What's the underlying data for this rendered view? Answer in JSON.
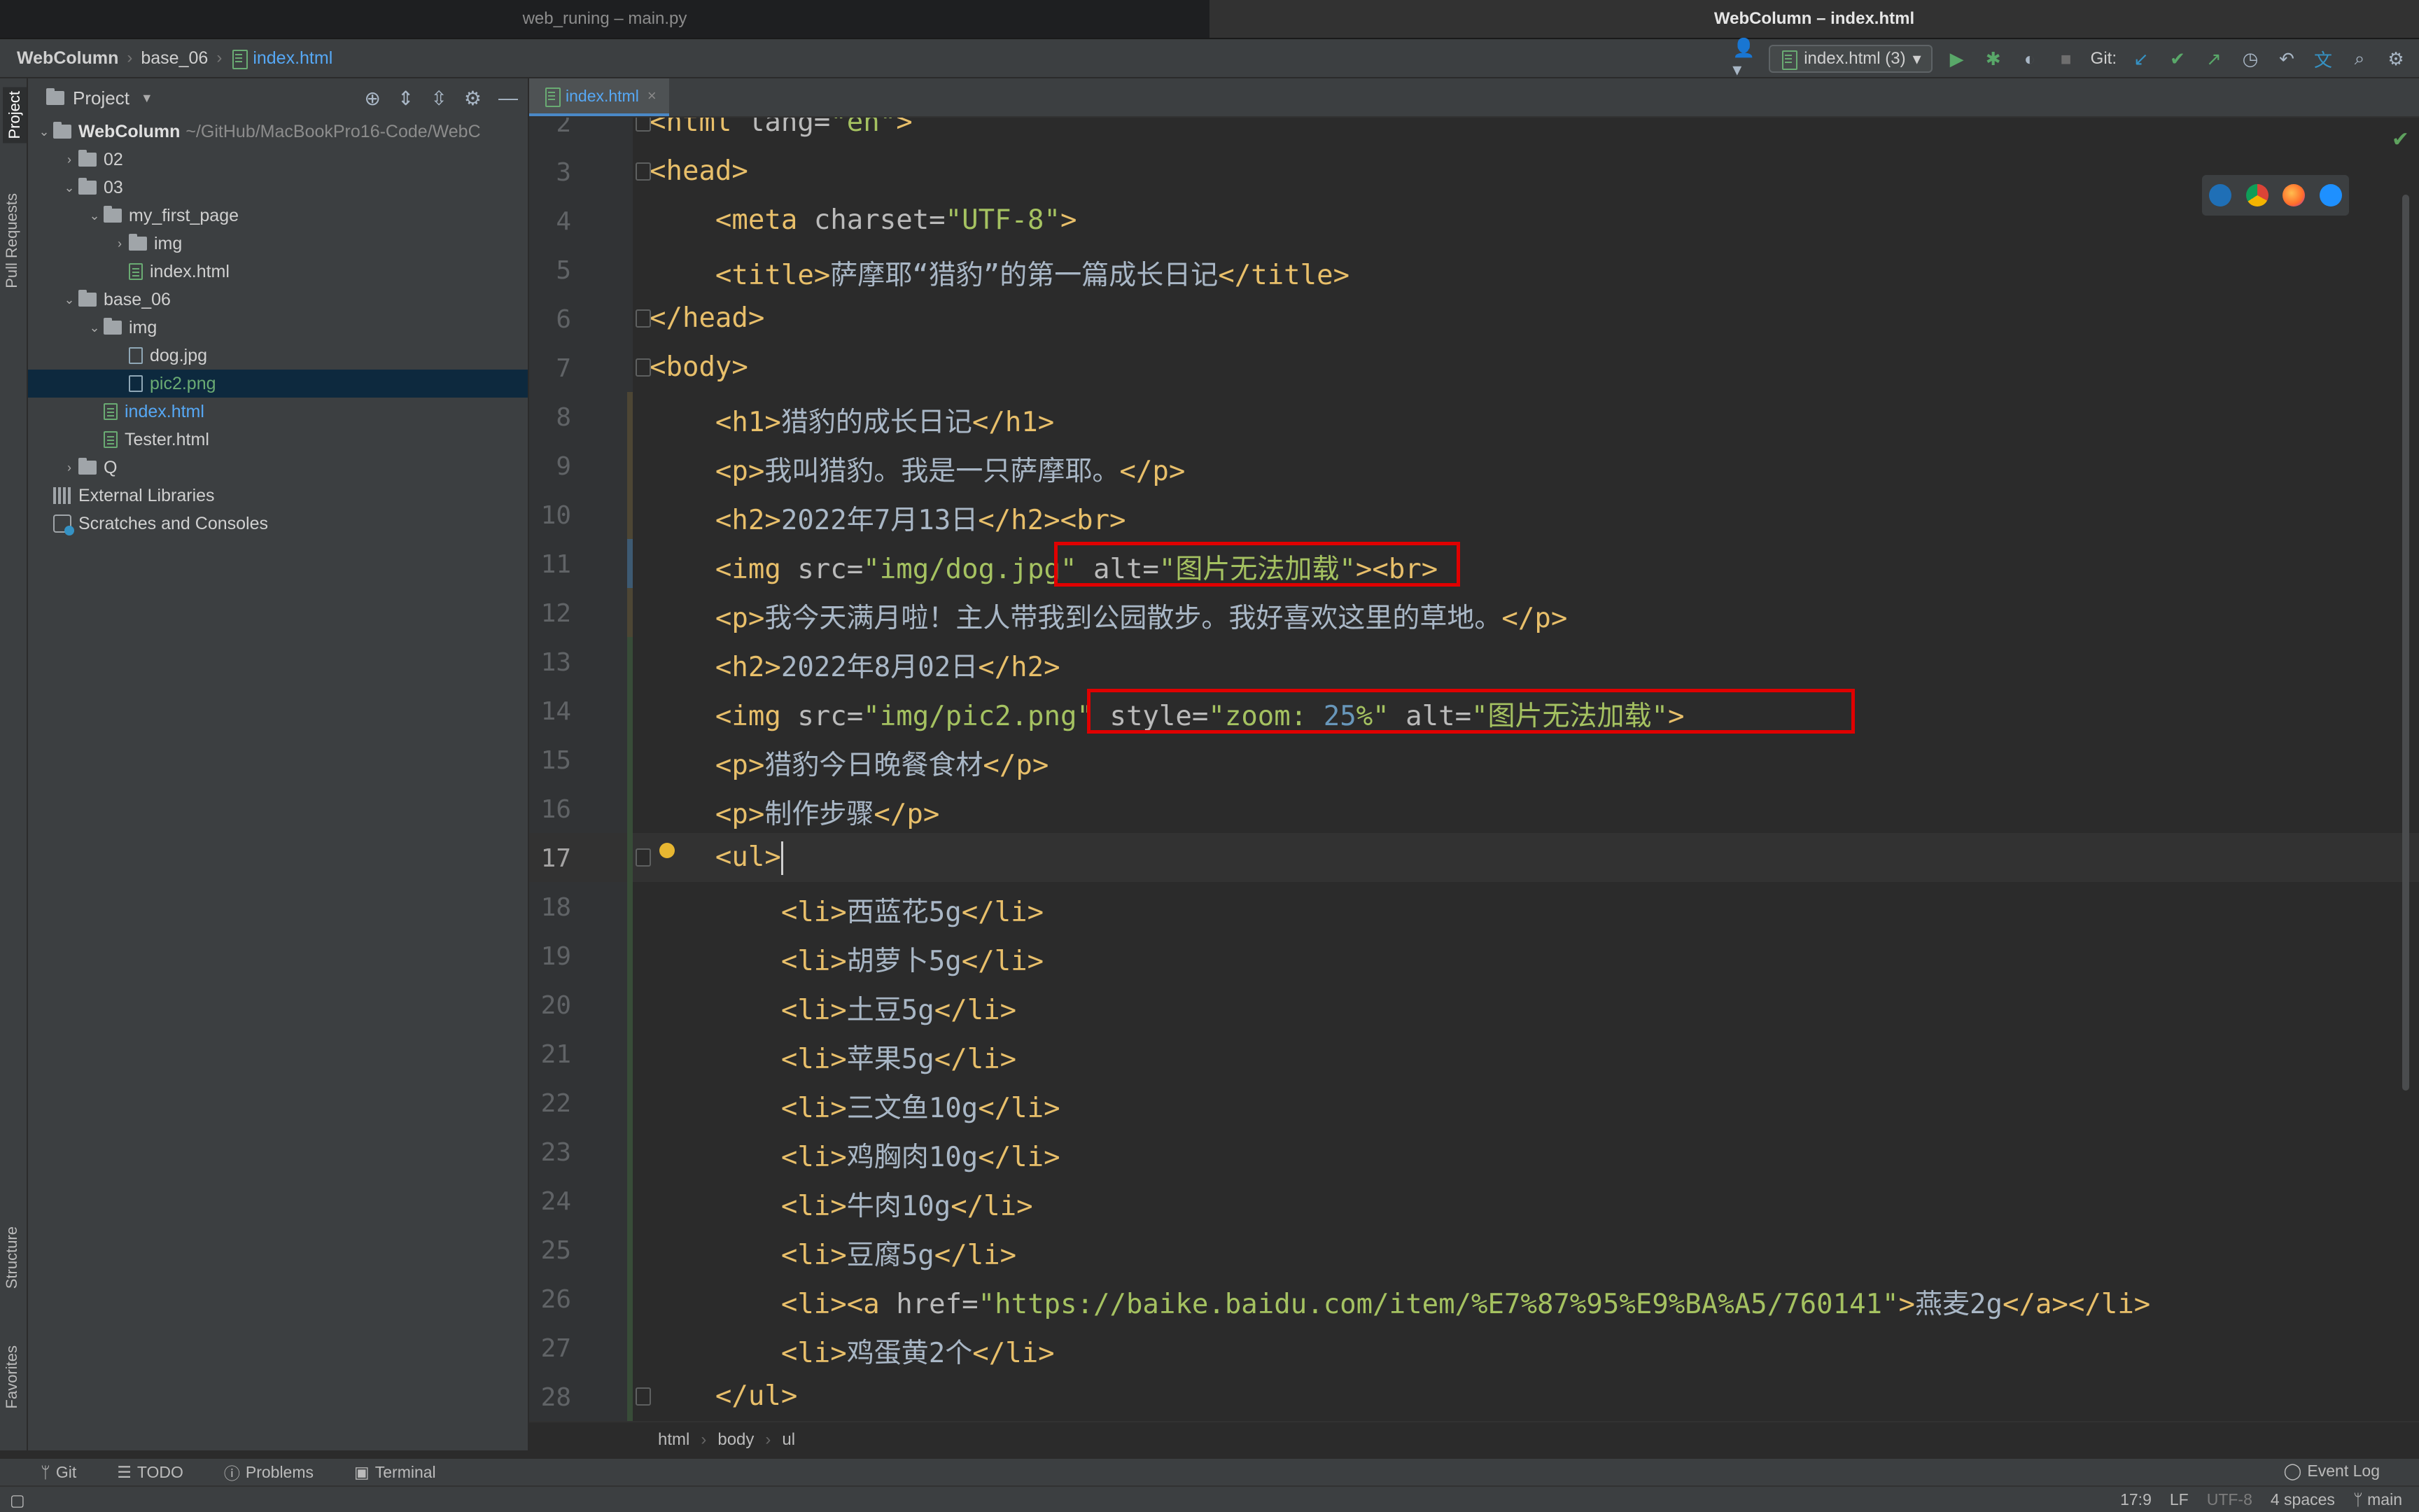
{
  "window_tabs": [
    "web_runing – main.py",
    "WebColumn – index.html"
  ],
  "breadcrumb": {
    "project": "WebColumn",
    "folder": "base_06",
    "file": "index.html"
  },
  "run_config": "index.html (3)",
  "git_label": "Git:",
  "left_strip": {
    "project": "Project",
    "pull_requests": "Pull Requests",
    "structure": "Structure",
    "favorites": "Favorites"
  },
  "project_panel": {
    "title": "Project",
    "tree": [
      {
        "label": "WebColumn",
        "path": "~/GitHub/MacBookPro16-Code/WebC",
        "type": "root",
        "depth": 0,
        "expanded": true
      },
      {
        "label": "02",
        "type": "folder",
        "depth": 1,
        "expanded": false
      },
      {
        "label": "03",
        "type": "folder",
        "depth": 1,
        "expanded": true
      },
      {
        "label": "my_first_page",
        "type": "folder",
        "depth": 2,
        "expanded": true
      },
      {
        "label": "img",
        "type": "folder",
        "depth": 3,
        "expanded": false
      },
      {
        "label": "index.html",
        "type": "html",
        "depth": 3
      },
      {
        "label": "base_06",
        "type": "folder",
        "depth": 1,
        "expanded": true
      },
      {
        "label": "img",
        "type": "folder",
        "depth": 2,
        "expanded": true
      },
      {
        "label": "dog.jpg",
        "type": "image",
        "depth": 3
      },
      {
        "label": "pic2.png",
        "type": "image",
        "depth": 3,
        "selected": true,
        "color": "green"
      },
      {
        "label": "index.html",
        "type": "html",
        "depth": 2,
        "color": "blue"
      },
      {
        "label": "Tester.html",
        "type": "html",
        "depth": 2
      },
      {
        "label": "Q",
        "type": "folder",
        "depth": 1,
        "expanded": false
      },
      {
        "label": "External Libraries",
        "type": "lib",
        "depth": 0
      },
      {
        "label": "Scratches and Consoles",
        "type": "scratch",
        "depth": 0
      }
    ]
  },
  "editor_tab": "index.html",
  "editor": {
    "current_line": 17,
    "lines": [
      {
        "n": 2,
        "t": [
          [
            "tag",
            "<html "
          ],
          [
            "attr",
            "lang="
          ],
          [
            "val",
            "\"en\""
          ],
          [
            "tag",
            ">"
          ]
        ]
      },
      {
        "n": 3,
        "t": [
          [
            "tag",
            "<head>"
          ]
        ]
      },
      {
        "n": 4,
        "t": [
          [
            "txt",
            "    "
          ],
          [
            "tag",
            "<meta "
          ],
          [
            "attr",
            "charset="
          ],
          [
            "val",
            "\"UTF-8\""
          ],
          [
            "tag",
            ">"
          ]
        ]
      },
      {
        "n": 5,
        "t": [
          [
            "txt",
            "    "
          ],
          [
            "tag",
            "<title>"
          ],
          [
            "txt",
            "萨摩耶“猎豹”的第一篇成长日记"
          ],
          [
            "tag",
            "</title>"
          ]
        ]
      },
      {
        "n": 6,
        "t": [
          [
            "tag",
            "</head>"
          ]
        ]
      },
      {
        "n": 7,
        "t": [
          [
            "tag",
            "<body>"
          ]
        ]
      },
      {
        "n": 8,
        "t": [
          [
            "txt",
            "    "
          ],
          [
            "tag",
            "<h1>"
          ],
          [
            "txt",
            "猎豹的成长日记"
          ],
          [
            "tag",
            "</h1>"
          ]
        ]
      },
      {
        "n": 9,
        "t": [
          [
            "txt",
            "    "
          ],
          [
            "tag",
            "<p>"
          ],
          [
            "txt",
            "我叫猎豹。我是一只萨摩耶。"
          ],
          [
            "tag",
            "</p>"
          ]
        ]
      },
      {
        "n": 10,
        "t": [
          [
            "txt",
            "    "
          ],
          [
            "tag",
            "<h2>"
          ],
          [
            "txt",
            "2022年7月13日"
          ],
          [
            "tag",
            "</h2><br>"
          ]
        ]
      },
      {
        "n": 11,
        "t": [
          [
            "txt",
            "    "
          ],
          [
            "tag",
            "<img "
          ],
          [
            "attr",
            "src="
          ],
          [
            "val",
            "\"img/dog.jpg\""
          ],
          [
            "txt",
            " "
          ],
          [
            "attr",
            "alt="
          ],
          [
            "val",
            "\"图片无法加载\""
          ],
          [
            "tag",
            "><br>"
          ]
        ]
      },
      {
        "n": 12,
        "t": [
          [
            "txt",
            "    "
          ],
          [
            "tag",
            "<p>"
          ],
          [
            "txt",
            "我今天满月啦！主人带我到公园散步。我好喜欢这里的草地。"
          ],
          [
            "tag",
            "</p>"
          ]
        ]
      },
      {
        "n": 13,
        "t": [
          [
            "txt",
            "    "
          ],
          [
            "tag",
            "<h2>"
          ],
          [
            "txt",
            "2022年8月02日"
          ],
          [
            "tag",
            "</h2>"
          ]
        ]
      },
      {
        "n": 14,
        "t": [
          [
            "txt",
            "    "
          ],
          [
            "tag",
            "<img "
          ],
          [
            "attr",
            "src="
          ],
          [
            "val",
            "\"img/pic2.png\""
          ],
          [
            "txt",
            " "
          ],
          [
            "attr",
            "style="
          ],
          [
            "val",
            "\"zoom: "
          ],
          [
            "num",
            "25"
          ],
          [
            "val",
            "%\""
          ],
          [
            "txt",
            " "
          ],
          [
            "attr",
            "alt="
          ],
          [
            "val",
            "\"图片无法加载\""
          ],
          [
            "tag",
            ">"
          ]
        ]
      },
      {
        "n": 15,
        "t": [
          [
            "txt",
            "    "
          ],
          [
            "tag",
            "<p>"
          ],
          [
            "txt",
            "猎豹今日晚餐食材"
          ],
          [
            "tag",
            "</p>"
          ]
        ]
      },
      {
        "n": 16,
        "t": [
          [
            "txt",
            "    "
          ],
          [
            "tag",
            "<p>"
          ],
          [
            "txt",
            "制作步骤"
          ],
          [
            "tag",
            "</p>"
          ]
        ]
      },
      {
        "n": 17,
        "t": [
          [
            "txt",
            "    "
          ],
          [
            "tag",
            "<ul>"
          ]
        ]
      },
      {
        "n": 18,
        "t": [
          [
            "txt",
            "        "
          ],
          [
            "tag",
            "<li>"
          ],
          [
            "txt",
            "西蓝花5g"
          ],
          [
            "tag",
            "</li>"
          ]
        ]
      },
      {
        "n": 19,
        "t": [
          [
            "txt",
            "        "
          ],
          [
            "tag",
            "<li>"
          ],
          [
            "txt",
            "胡萝卜5g"
          ],
          [
            "tag",
            "</li>"
          ]
        ]
      },
      {
        "n": 20,
        "t": [
          [
            "txt",
            "        "
          ],
          [
            "tag",
            "<li>"
          ],
          [
            "txt",
            "土豆5g"
          ],
          [
            "tag",
            "</li>"
          ]
        ]
      },
      {
        "n": 21,
        "t": [
          [
            "txt",
            "        "
          ],
          [
            "tag",
            "<li>"
          ],
          [
            "txt",
            "苹果5g"
          ],
          [
            "tag",
            "</li>"
          ]
        ]
      },
      {
        "n": 22,
        "t": [
          [
            "txt",
            "        "
          ],
          [
            "tag",
            "<li>"
          ],
          [
            "txt",
            "三文鱼10g"
          ],
          [
            "tag",
            "</li>"
          ]
        ]
      },
      {
        "n": 23,
        "t": [
          [
            "txt",
            "        "
          ],
          [
            "tag",
            "<li>"
          ],
          [
            "txt",
            "鸡胸肉10g"
          ],
          [
            "tag",
            "</li>"
          ]
        ]
      },
      {
        "n": 24,
        "t": [
          [
            "txt",
            "        "
          ],
          [
            "tag",
            "<li>"
          ],
          [
            "txt",
            "牛肉10g"
          ],
          [
            "tag",
            "</li>"
          ]
        ]
      },
      {
        "n": 25,
        "t": [
          [
            "txt",
            "        "
          ],
          [
            "tag",
            "<li>"
          ],
          [
            "txt",
            "豆腐5g"
          ],
          [
            "tag",
            "</li>"
          ]
        ]
      },
      {
        "n": 26,
        "t": [
          [
            "txt",
            "        "
          ],
          [
            "tag",
            "<li><a "
          ],
          [
            "attr",
            "href="
          ],
          [
            "val",
            "\"https://baike.baidu.com/item/%E7%87%95%E9%BA%A5/760141\""
          ],
          [
            "tag",
            ">"
          ],
          [
            "txt",
            "燕麦2g"
          ],
          [
            "tag",
            "</a></li>"
          ]
        ]
      },
      {
        "n": 27,
        "t": [
          [
            "txt",
            "        "
          ],
          [
            "tag",
            "<li>"
          ],
          [
            "txt",
            "鸡蛋黄2个"
          ],
          [
            "tag",
            "</li>"
          ]
        ]
      },
      {
        "n": 28,
        "t": [
          [
            "txt",
            "    "
          ],
          [
            "tag",
            "</ul>"
          ]
        ]
      }
    ]
  },
  "editor_breadcrumbs": [
    "html",
    "body",
    "ul"
  ],
  "bottom_tools": [
    "Git",
    "TODO",
    "Problems",
    "Terminal"
  ],
  "event_log": "Event Log",
  "status": {
    "position": "17:9",
    "line_sep": "LF",
    "encoding": "UTF-8",
    "indent": "4 spaces",
    "branch": "main"
  },
  "colors": {
    "accent": "#4a88c7",
    "highlight_box": "#e00000",
    "tag": "#e8bf6a",
    "string": "#a5c261"
  }
}
